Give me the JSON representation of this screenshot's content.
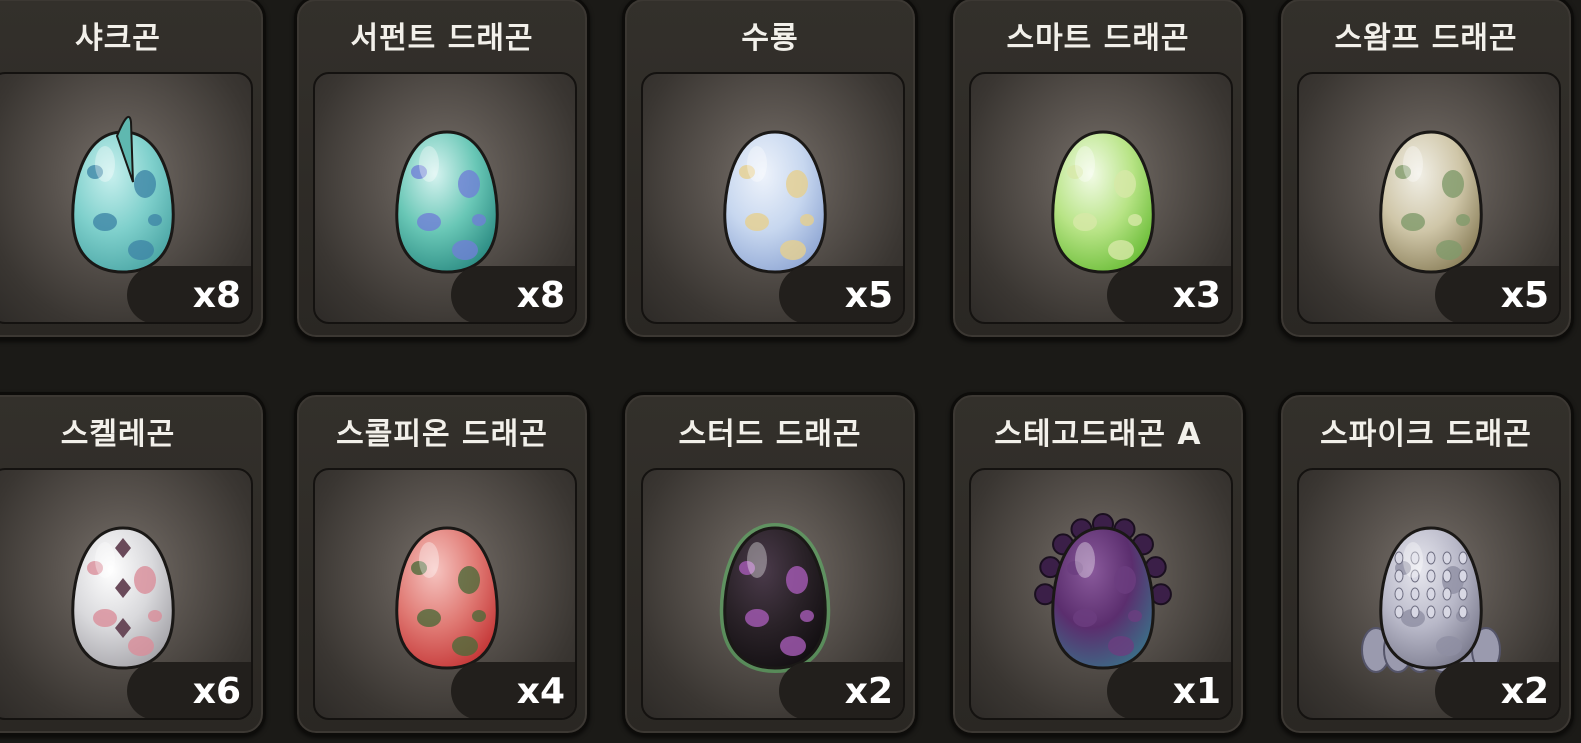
{
  "eggs": [
    {
      "name": "샤크곤",
      "count": "x8",
      "icon": "shark-dragon-egg-icon",
      "colors": [
        "#c8f0ee",
        "#7fd0cc",
        "#4fa9a8"
      ],
      "spot": "#3f86a6"
    },
    {
      "name": "서펀트 드래곤",
      "count": "x8",
      "icon": "serpent-dragon-egg-icon",
      "colors": [
        "#d6f3f0",
        "#69c7b6",
        "#2f8f86"
      ],
      "spot": "#6f7fd6"
    },
    {
      "name": "수룡",
      "count": "x5",
      "icon": "water-dragon-egg-icon",
      "colors": [
        "#eef3fb",
        "#c7d7ef",
        "#93aad6"
      ],
      "spot": "#e6d08e"
    },
    {
      "name": "스마트 드래곤",
      "count": "x3",
      "icon": "smart-dragon-egg-icon",
      "colors": [
        "#f2fbe6",
        "#b8e486",
        "#6fbf3c"
      ],
      "spot": "#d7e9a8"
    },
    {
      "name": "스왐프 드래곤",
      "count": "x5",
      "icon": "swamp-dragon-egg-icon",
      "colors": [
        "#f1efe6",
        "#cfc6a8",
        "#8f845f"
      ],
      "spot": "#7f9a6a"
    },
    {
      "name": "스켈레곤",
      "count": "x6",
      "icon": "skelegon-egg-icon",
      "colors": [
        "#ffffff",
        "#d9d9dc",
        "#a8a7ac"
      ],
      "spot": "#d98d9a"
    },
    {
      "name": "스콜피온 드래곤",
      "count": "x4",
      "icon": "scorpion-dragon-egg-icon",
      "colors": [
        "#f6c4c0",
        "#e07a74",
        "#c63a3a"
      ],
      "spot": "#4e6a3a"
    },
    {
      "name": "스터드 드래곤",
      "count": "x2",
      "icon": "stud-dragon-egg-icon",
      "colors": [
        "#4a3a4a",
        "#2a2228",
        "#141013"
      ],
      "spot": "#a65bb6"
    },
    {
      "name": "스테고드래곤 A",
      "count": "x1",
      "icon": "stegodragon-egg-icon",
      "colors": [
        "#8a5a9c",
        "#5b2e6e",
        "#3d6a86"
      ],
      "spot": "#6c3d80"
    },
    {
      "name": "스파이크 드래곤",
      "count": "x2",
      "icon": "spike-dragon-egg-icon",
      "colors": [
        "#e8e8ef",
        "#b8b8c8",
        "#7f7f92"
      ],
      "spot": "#8e8ea2"
    }
  ]
}
